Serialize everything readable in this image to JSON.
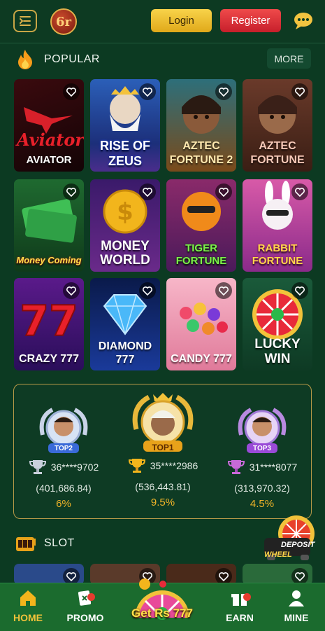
{
  "header": {
    "login_label": "Login",
    "register_label": "Register",
    "logo_text": "6r"
  },
  "popular": {
    "title": "POPULAR",
    "more_label": "MORE",
    "games": [
      {
        "name": "AVIATOR",
        "art_text": "Aviator"
      },
      {
        "name": "RISE OF ZEUS"
      },
      {
        "name": "AZTEC FORTUNE 2"
      },
      {
        "name": "AZTEC FORTUNE"
      },
      {
        "name": "Money Coming"
      },
      {
        "name": "MONEY WORLD"
      },
      {
        "name": "TIGER FORTUNE"
      },
      {
        "name": "RABBIT FORTUNE"
      },
      {
        "name": "CRAZY 777"
      },
      {
        "name": "DIAMOND 777"
      },
      {
        "name": "CANDY 777"
      },
      {
        "name": "LUCKY WIN"
      }
    ]
  },
  "leaderboard": {
    "ranks": [
      {
        "badge": "TOP2",
        "user": "36****9702",
        "amount": "(401,686.84)",
        "percent": "6%"
      },
      {
        "badge": "TOP1",
        "user": "35****2986",
        "amount": "(536,443.81)",
        "percent": "9.5%"
      },
      {
        "badge": "TOP3",
        "user": "31****8077",
        "amount": "(313,970.32)",
        "percent": "4.5%"
      }
    ]
  },
  "slot": {
    "title": "SLOT"
  },
  "deposit_wheel": {
    "line1": "DEPOSIT",
    "line2": "WHEEL"
  },
  "nav": {
    "home": "HOME",
    "promo": "PROMO",
    "center": "Get Rs 777",
    "earn": "EARN",
    "mine": "MINE"
  },
  "colors": {
    "accent_gold": "#f0b429",
    "bg": "#0c3a22",
    "nav": "#1b6b2e"
  }
}
